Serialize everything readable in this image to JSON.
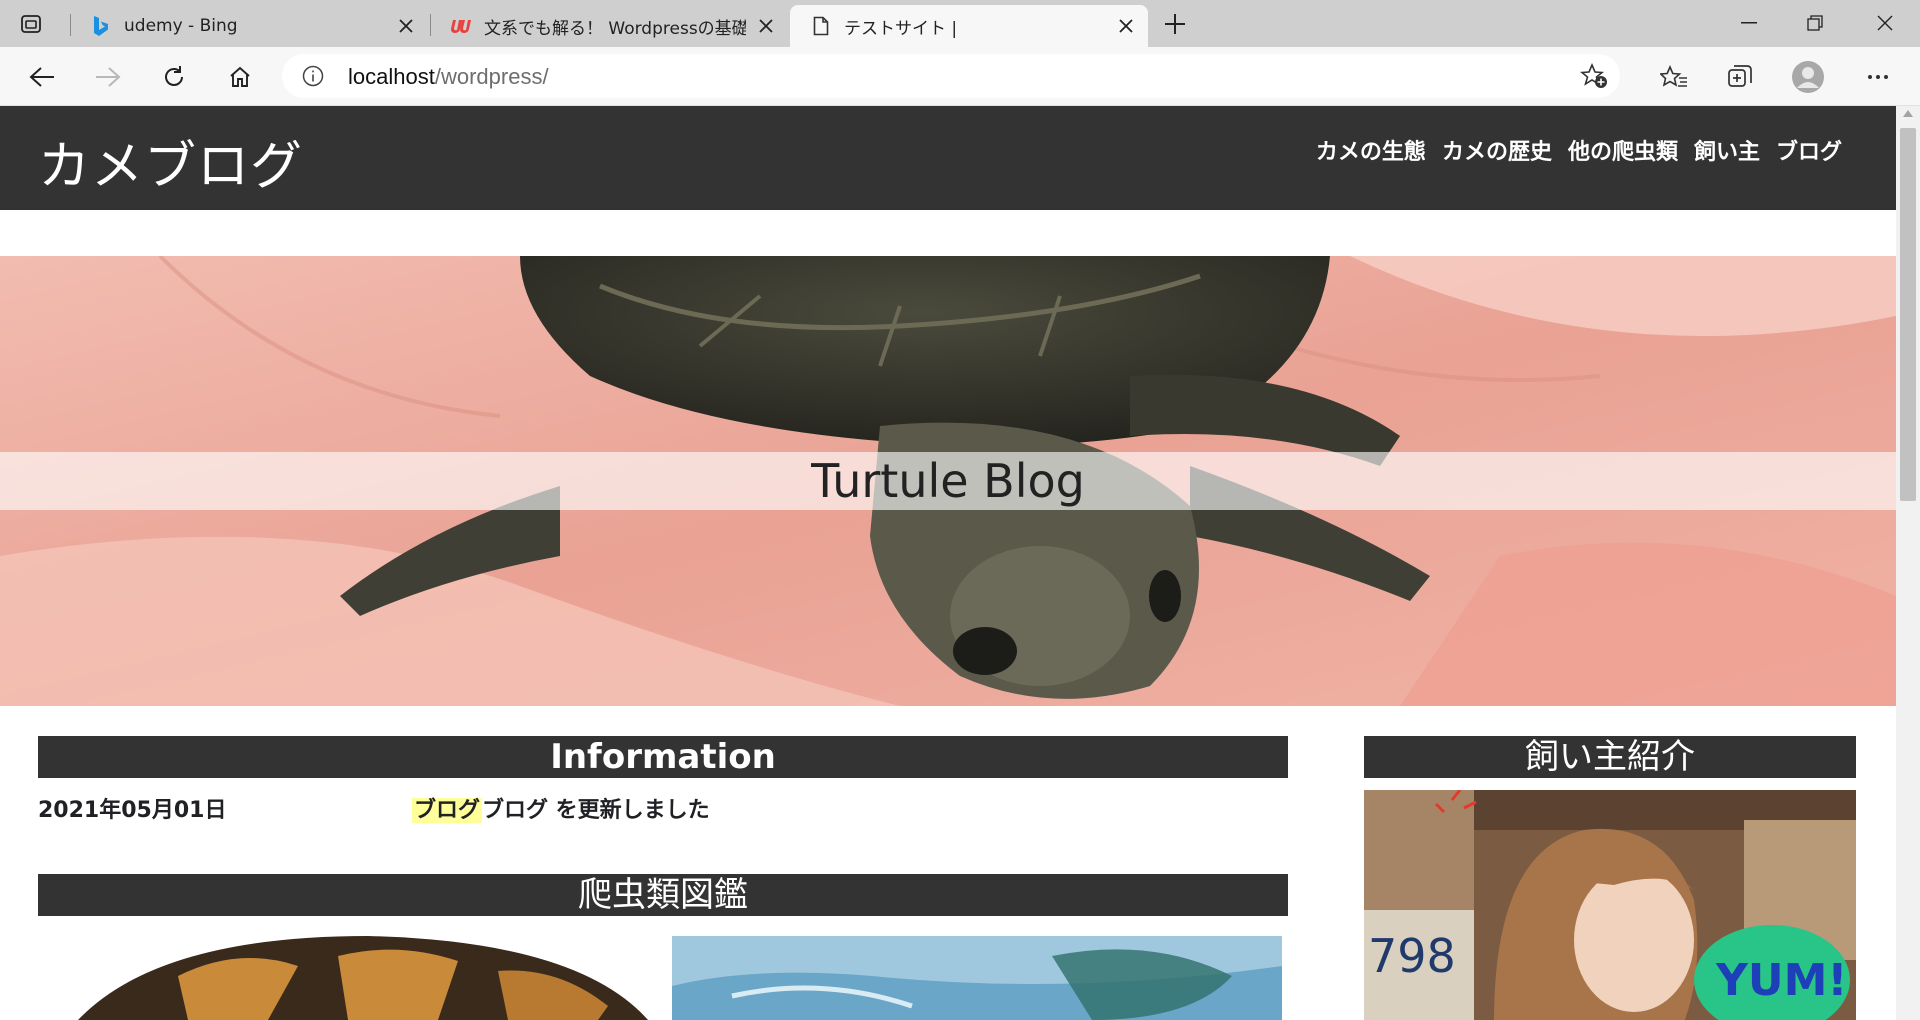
{
  "browser": {
    "tabs": [
      {
        "title": "udemy - Bing",
        "favicon": "bing-icon",
        "active": false
      },
      {
        "title": "文系でも解る！ Wordpressの基礎(",
        "favicon": "udemy-icon",
        "active": false
      },
      {
        "title": "テストサイト |",
        "favicon": "page-icon",
        "active": true
      }
    ],
    "url_host": "localhost",
    "url_path": "/wordpress/"
  },
  "site": {
    "title": "カメブログ",
    "nav": [
      "カメの生態",
      "カメの歴史",
      "他の爬虫類",
      "飼い主",
      "ブログ"
    ],
    "hero_title": "Turtule Blog",
    "information": {
      "heading": "Information",
      "date": "2021年05月01日",
      "category": "ブログ",
      "message": "ブログ を更新しました"
    },
    "zukan_heading": "爬虫類図鑑",
    "owner_heading": "飼い主紹介",
    "photo_texts": {
      "sign_number": "798",
      "yum": "YUM!"
    }
  },
  "colors": {
    "header_bg": "#333333",
    "tabstrip_bg": "#cfcfcf",
    "toolbar_bg": "#f7f7f7",
    "category_highlight": "#ffff99"
  }
}
